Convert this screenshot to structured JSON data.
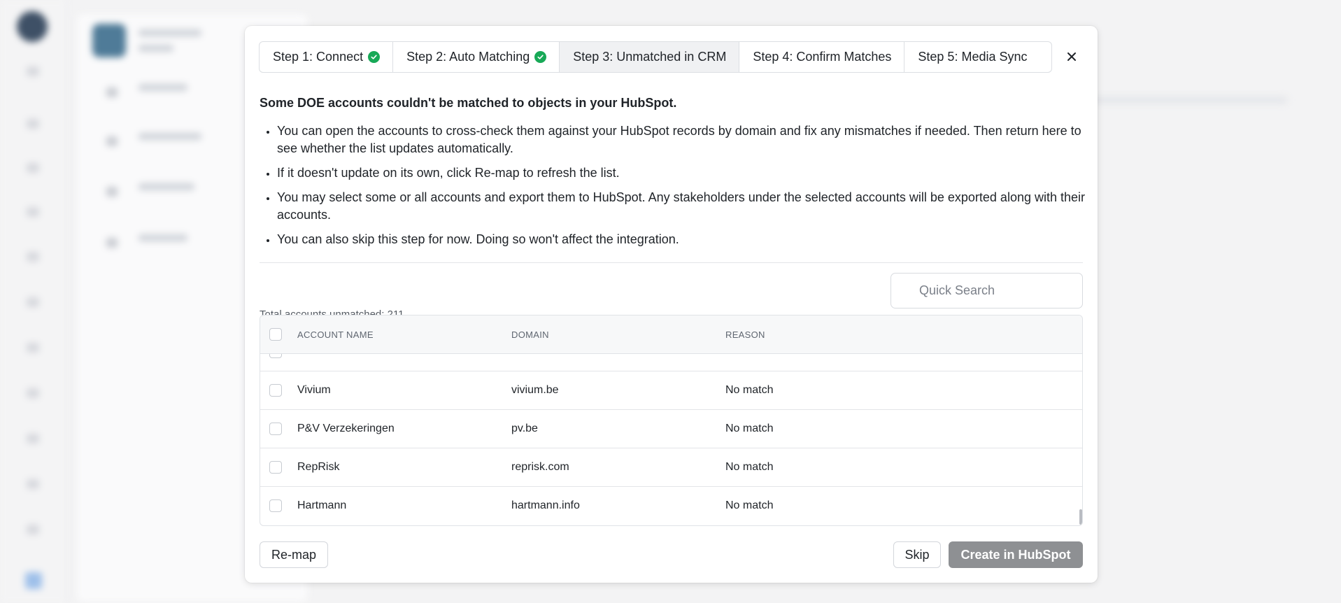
{
  "steps": [
    {
      "label": "Step 1: Connect",
      "completed": true
    },
    {
      "label": "Step 2: Auto Matching",
      "completed": true
    },
    {
      "label": "Step 3: Unmatched in CRM",
      "active": true
    },
    {
      "label": "Step 4: Confirm Matches"
    },
    {
      "label": "Step 5: Media Sync"
    }
  ],
  "close_icon": "close-icon",
  "intro": "Some DOE accounts couldn't be matched to objects in your HubSpot.",
  "bullets": [
    "You can open the accounts to cross-check them against your HubSpot records by domain and fix any mismatches if needed. Then return here to see whether the list updates automatically.",
    "If it doesn't update on its own, click Re-map to refresh the list.",
    "You may select some or all accounts and export them to HubSpot. Any stakeholders under the selected accounts will be exported along with their accounts.",
    "You can also skip this step for now. Doing so won't affect the integration."
  ],
  "total_label": "Total accounts unmatched: 211",
  "search": {
    "placeholder": "Quick Search",
    "value": ""
  },
  "table": {
    "columns": [
      "ACCOUNT NAME",
      "DOMAIN",
      "REASON"
    ],
    "rows": [
      {
        "name": "Vivium",
        "domain": "vivium.be",
        "reason": "No match"
      },
      {
        "name": "P&V Verzekeringen",
        "domain": "pv.be",
        "reason": "No match"
      },
      {
        "name": "RepRisk",
        "domain": "reprisk.com",
        "reason": "No match"
      },
      {
        "name": "Hartmann",
        "domain": "hartmann.info",
        "reason": "No match"
      }
    ]
  },
  "buttons": {
    "remap": "Re-map",
    "skip": "Skip",
    "create": "Create in HubSpot"
  },
  "colors": {
    "check": "#18a957",
    "create_button": "#8e9093",
    "active_step": "#f0f1f3"
  }
}
